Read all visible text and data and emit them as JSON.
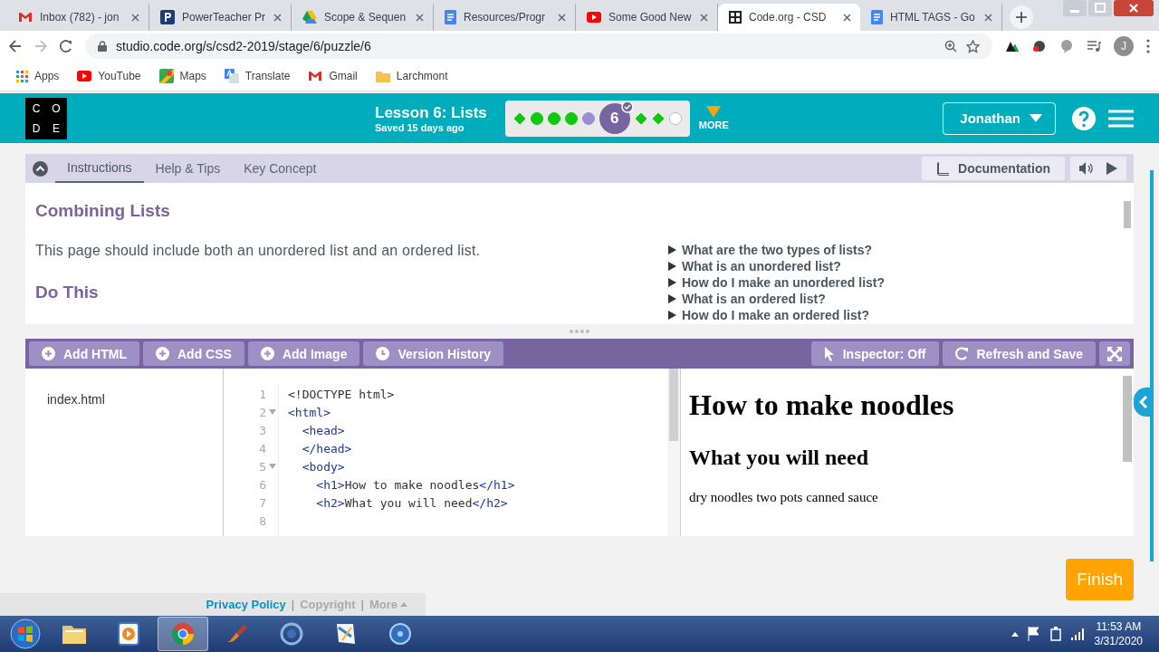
{
  "browser": {
    "tabs": [
      {
        "title": "Inbox (782) - jon",
        "selected": false
      },
      {
        "title": "PowerTeacher Pr",
        "selected": false
      },
      {
        "title": "Scope & Sequen",
        "selected": false
      },
      {
        "title": "Resources/Progr",
        "selected": false
      },
      {
        "title": "Some Good New",
        "selected": false
      },
      {
        "title": "Code.org - CSD",
        "selected": true
      },
      {
        "title": "HTML TAGS - Go",
        "selected": false
      }
    ],
    "url": "studio.code.org/s/csd2-2019/stage/6/puzzle/6",
    "avatar": "J",
    "bookmarks": [
      "Apps",
      "YouTube",
      "Maps",
      "Translate",
      "Gmail",
      "Larchmont"
    ]
  },
  "header": {
    "logo_letters": [
      "C",
      "O",
      "D",
      "E"
    ],
    "lesson_title": "Lesson 6: Lists",
    "saved": "Saved 15 days ago",
    "progress": [
      {
        "kind": "diamond",
        "completed": true,
        "attempted": true
      },
      {
        "kind": "dot",
        "completed": true,
        "attempted": true
      },
      {
        "kind": "dot",
        "completed": true,
        "attempted": true
      },
      {
        "kind": "dot",
        "completed": true,
        "attempted": true
      },
      {
        "kind": "dot",
        "completed": false,
        "attempted": true
      },
      {
        "kind": "current",
        "label": "6",
        "completed": true,
        "attempted": true
      },
      {
        "kind": "diamond",
        "completed": true,
        "attempted": true
      },
      {
        "kind": "diamond",
        "completed": true,
        "attempted": true
      },
      {
        "kind": "dot",
        "completed": false,
        "attempted": false
      }
    ],
    "more": "MORE",
    "user": "Jonathan"
  },
  "instructions": {
    "tabs": [
      {
        "label": "Instructions",
        "selected": true
      },
      {
        "label": "Help & Tips",
        "selected": false
      },
      {
        "label": "Key Concept",
        "selected": false
      }
    ],
    "documentation": "Documentation",
    "heading": "Combining Lists",
    "paragraph": "This page should include both an unordered list and an ordered list.",
    "subheading": "Do This",
    "questions": [
      "What are the two types of lists?",
      "What is an unordered list?",
      "How do I make an unordered list?",
      "What is an ordered list?",
      "How do I make an ordered list?"
    ]
  },
  "editor": {
    "left_buttons": [
      "Add HTML",
      "Add CSS",
      "Add Image",
      "Version History"
    ],
    "right_buttons": [
      "Inspector: Off",
      "Refresh and Save"
    ],
    "files": [
      "index.html"
    ],
    "code_lines": [
      {
        "number": "1",
        "text": "<!DOCTYPE html>",
        "foldable": false
      },
      {
        "number": "2",
        "text": "<html>",
        "foldable": true
      },
      {
        "number": "3",
        "text": "  <head>",
        "foldable": false
      },
      {
        "number": "4",
        "text": "  </head>",
        "foldable": false
      },
      {
        "number": "5",
        "text": "  <body>",
        "foldable": true
      },
      {
        "number": "6",
        "text": "    <h1>How to make noodles</h1>",
        "foldable": false
      },
      {
        "number": "7",
        "text": "    <h2>What you will need</h2>",
        "foldable": false
      },
      {
        "number": "8",
        "foldable": false
      }
    ],
    "preview": {
      "h1": "How to make noodles",
      "h2": "What you will need",
      "body": "dry noodles two pots canned sauce"
    }
  },
  "finish": "Finish",
  "footer": {
    "items": [
      {
        "label": "Privacy Policy",
        "kind": "primary"
      },
      {
        "label": "|",
        "kind": "separator"
      },
      {
        "label": "Copyright",
        "kind": "muted"
      },
      {
        "label": "|",
        "kind": "separator"
      },
      {
        "label": "More",
        "kind": "menu"
      }
    ]
  },
  "taskbar": {
    "apps": [
      {
        "active": false
      },
      {
        "active": false
      },
      {
        "active": true
      },
      {
        "active": false
      },
      {
        "active": false
      },
      {
        "active": false
      },
      {
        "active": false
      }
    ],
    "time": "11:53 AM",
    "date": "3/31/2020"
  }
}
